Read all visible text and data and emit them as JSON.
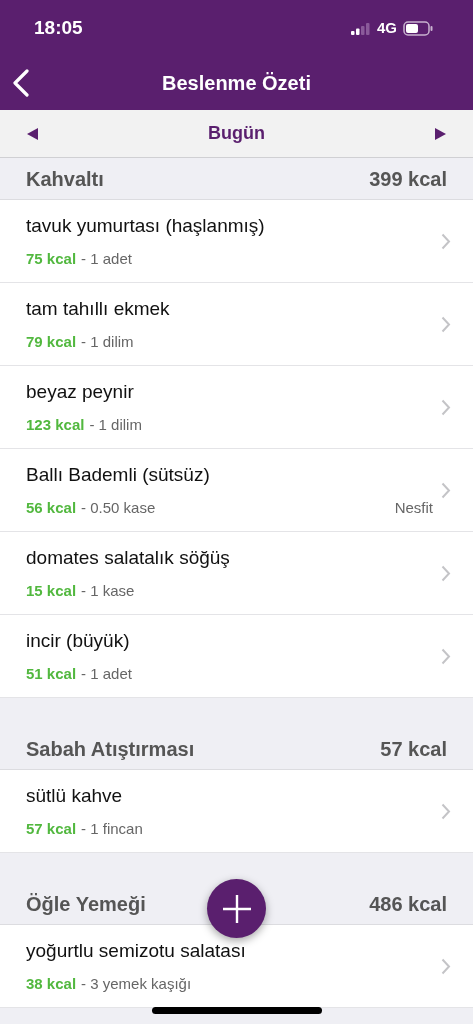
{
  "status_bar": {
    "time": "18:05",
    "network": "4G"
  },
  "nav": {
    "title": "Beslenme Özeti"
  },
  "date_bar": {
    "label": "Bugün"
  },
  "sections": [
    {
      "title": "Kahvaltı",
      "total": "399 kcal",
      "items": [
        {
          "name": "tavuk yumurtası (haşlanmış)",
          "kcal": "75 kcal",
          "portion": "- 1 adet"
        },
        {
          "name": "tam tahıllı ekmek",
          "kcal": "79 kcal",
          "portion": "- 1 dilim"
        },
        {
          "name": "beyaz peynir",
          "kcal": "123 kcal",
          "portion": "- 1 dilim"
        },
        {
          "name": "Ballı Bademli (sütsüz)",
          "kcal": "56 kcal",
          "portion": "- 0.50 kase",
          "brand": "Nesfit"
        },
        {
          "name": "domates salatalık söğüş",
          "kcal": "15 kcal",
          "portion": "- 1 kase"
        },
        {
          "name": "incir (büyük)",
          "kcal": "51 kcal",
          "portion": "- 1 adet"
        }
      ]
    },
    {
      "title": "Sabah Atıştırması",
      "total": "57 kcal",
      "items": [
        {
          "name": "sütlü kahve",
          "kcal": "57 kcal",
          "portion": "- 1 fincan"
        }
      ]
    },
    {
      "title": "Öğle Yemeği",
      "total": "486 kcal",
      "items": [
        {
          "name": "yoğurtlu semizotu salatası",
          "kcal": "38 kcal",
          "portion": "- 3 yemek kaşığı"
        }
      ]
    }
  ]
}
